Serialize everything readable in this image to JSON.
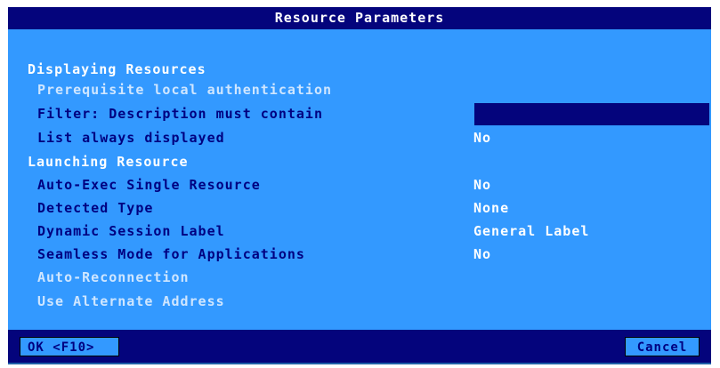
{
  "dialog": {
    "title": "Resource Parameters"
  },
  "sections": {
    "displaying": "Displaying Resources",
    "launching": "Launching Resource"
  },
  "fields": {
    "prereq_auth": {
      "label": "Prerequisite local authentication"
    },
    "filter_desc": {
      "label": "Filter: Description must contain",
      "value": ""
    },
    "list_always": {
      "label": "List always displayed",
      "value": "No"
    },
    "auto_exec": {
      "label": "Auto-Exec Single Resource",
      "value": "No"
    },
    "detected_type": {
      "label": "Detected Type",
      "value": "None"
    },
    "dynamic_label": {
      "label": "Dynamic Session Label",
      "value": "General Label"
    },
    "seamless": {
      "label": "Seamless Mode for Applications",
      "value": "No"
    },
    "auto_reconnect": {
      "label": "Auto-Reconnection"
    },
    "alt_address": {
      "label": "Use Alternate Address"
    }
  },
  "buttons": {
    "ok": "OK <F10>",
    "cancel": "Cancel"
  },
  "colors": {
    "window_bg": "#3399ff",
    "bar_bg": "#04047c",
    "label_text": "#000080",
    "section_text": "#ffffff",
    "disabled_text": "#cfe6ff"
  }
}
